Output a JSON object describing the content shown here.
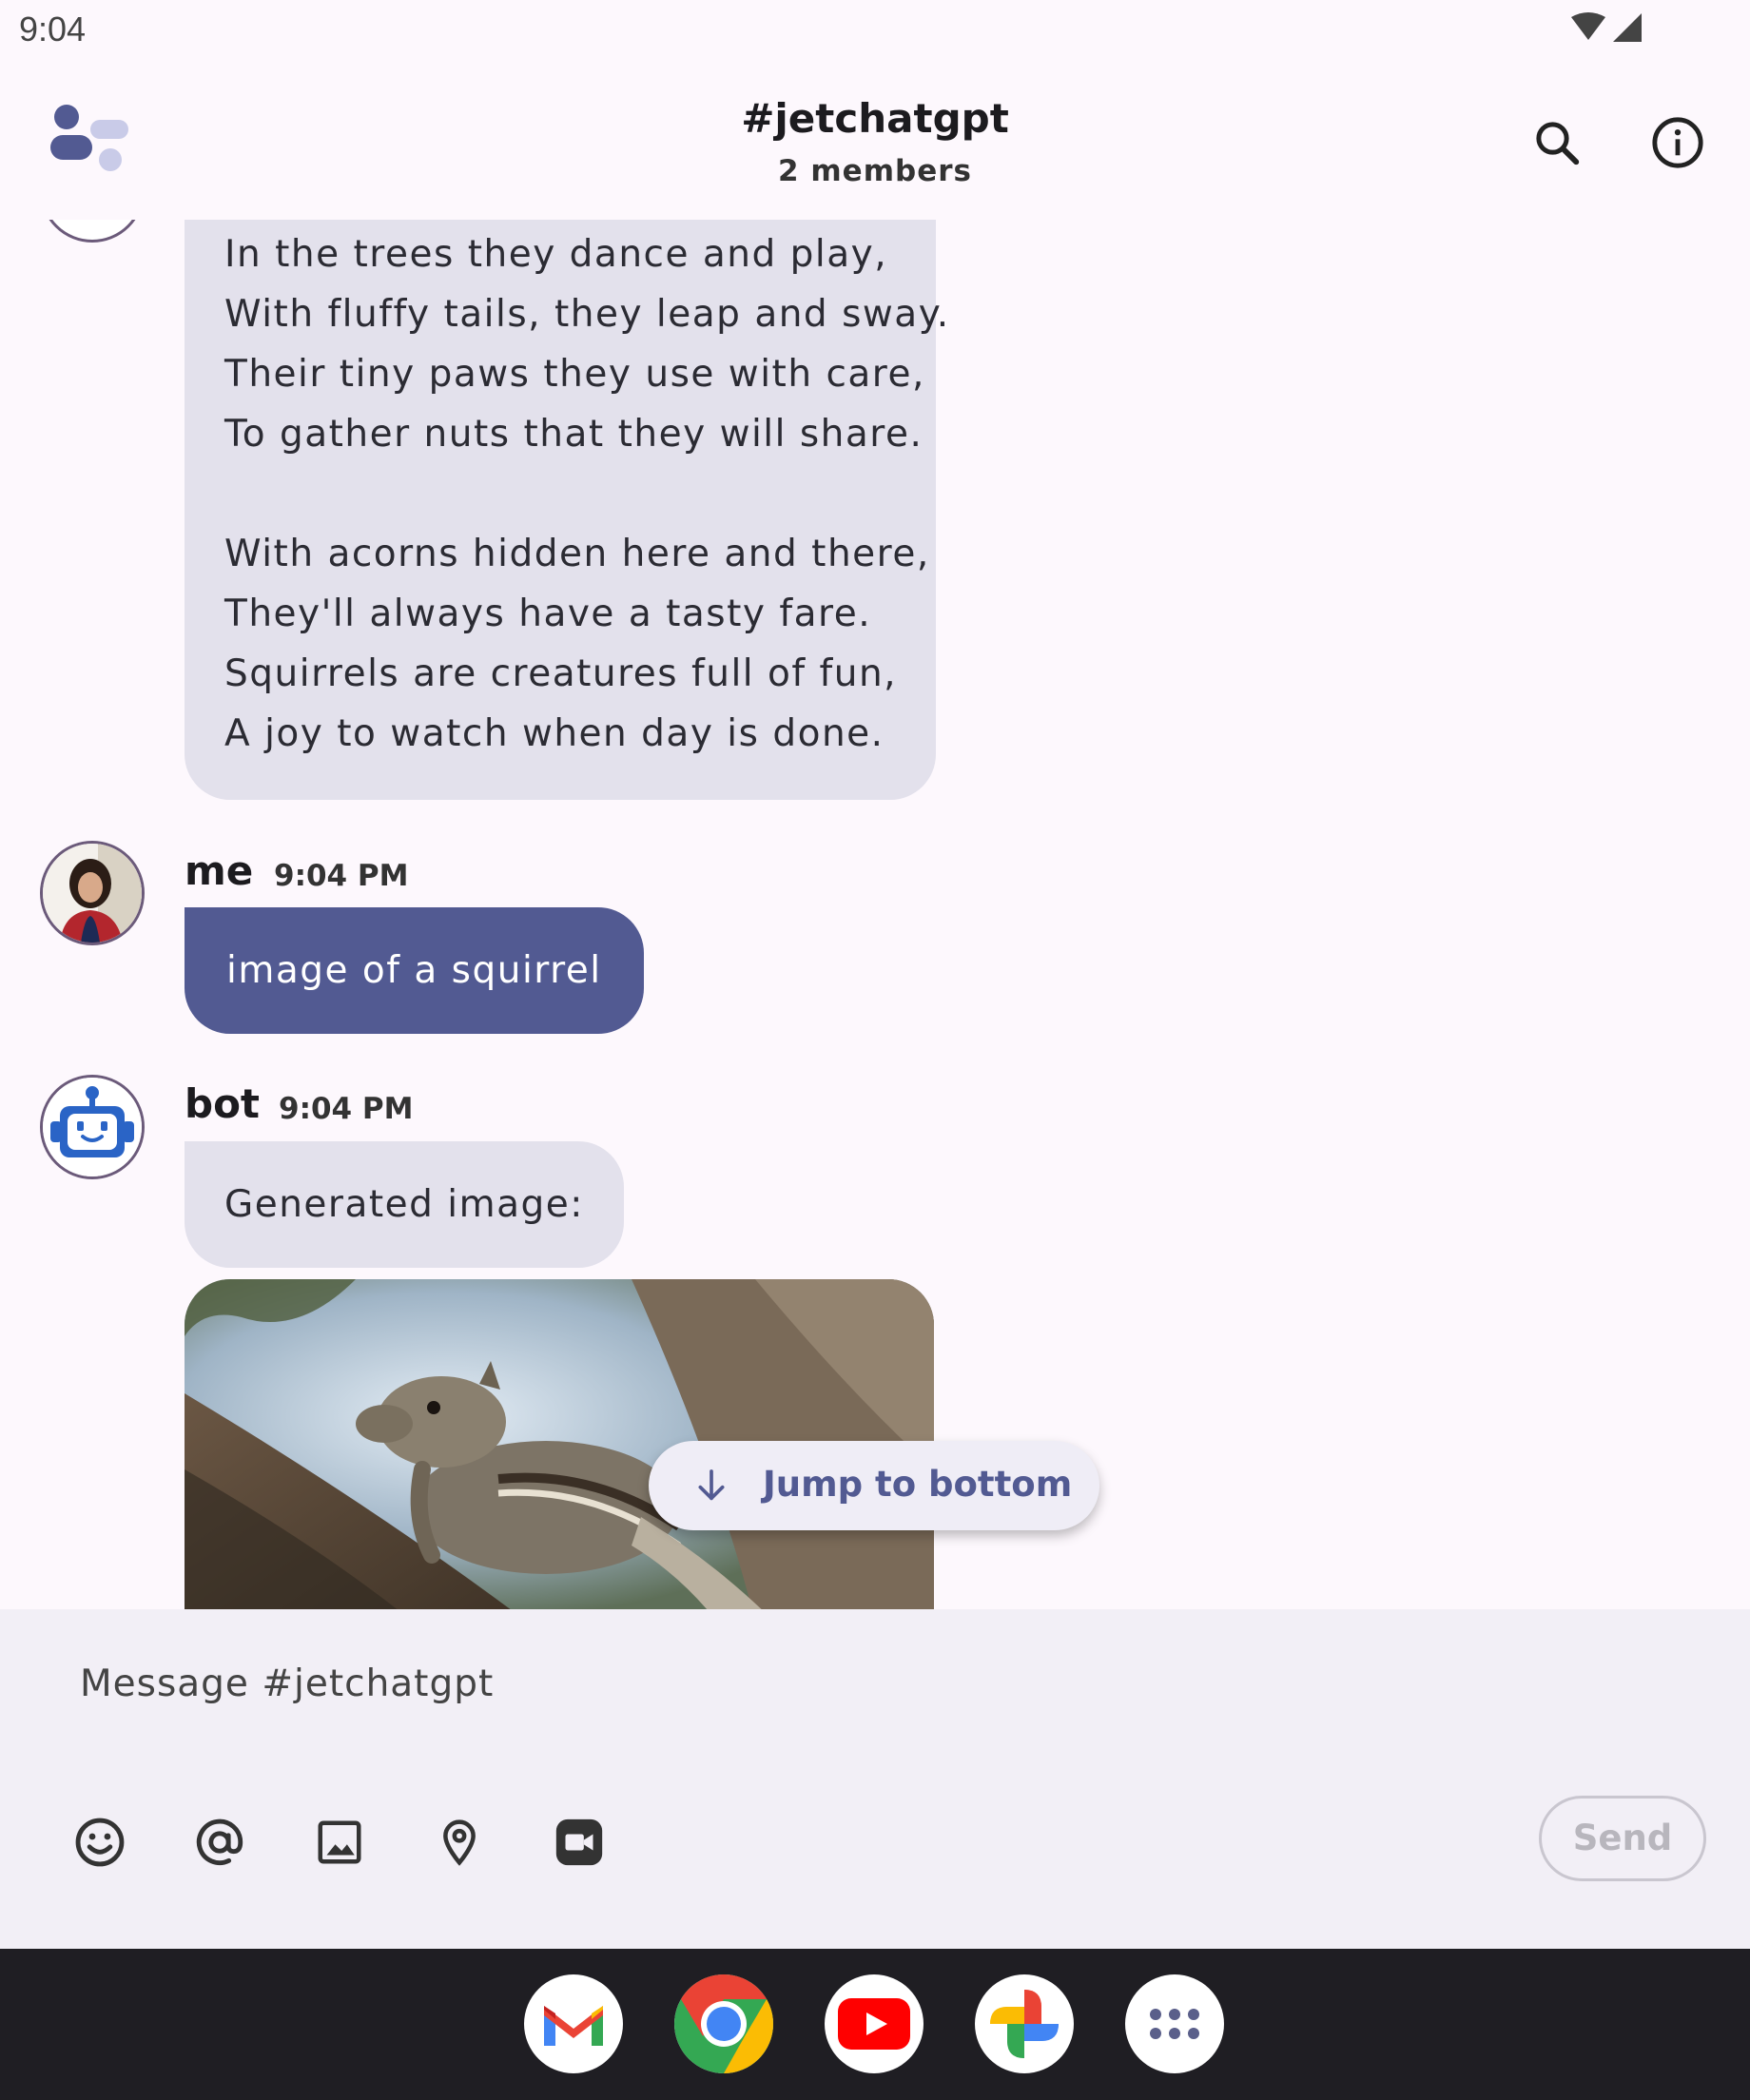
{
  "status_bar": {
    "time": "9:04"
  },
  "app_bar": {
    "title": "#jetchatgpt",
    "subtitle": "2 members",
    "icons": [
      "jetchat-logo-icon",
      "search-icon",
      "info-icon"
    ]
  },
  "messages": {
    "poem_lines": [
      "In the trees they dance and play,",
      "With fluffy tails, they leap and sway.",
      "Their tiny paws they use with care,",
      "To gather nuts that they will share.",
      "",
      "With acorns hidden here and there,",
      "They'll always have a tasty fare.",
      "Squirrels are creatures full of fun,",
      "A joy to watch when day is done."
    ],
    "me": {
      "author": "me",
      "time": "9:04 PM",
      "text": "image of a squirrel"
    },
    "bot": {
      "author": "bot",
      "time": "9:04 PM",
      "text": "Generated image:"
    }
  },
  "jump_button": {
    "label": "Jump to bottom"
  },
  "composer": {
    "placeholder": "Message #jetchatgpt",
    "send_label": "Send",
    "icons": [
      "emoji-icon",
      "mention-icon",
      "image-icon",
      "location-icon",
      "video-icon"
    ]
  },
  "dock": {
    "apps": [
      "gmail-icon",
      "chrome-icon",
      "youtube-icon",
      "photos-icon",
      "app-drawer-icon"
    ]
  },
  "colors": {
    "accent": "#525a92",
    "bubble_in": "#e3e1ec",
    "background": "#fdf8fd"
  }
}
